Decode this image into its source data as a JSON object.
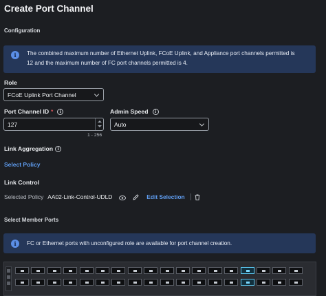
{
  "page": {
    "title": "Create Port Channel",
    "configuration_label": "Configuration",
    "info_banner_1": {
      "line1": "The combined maximum number of Ethernet Uplink, FCoE Uplink, and Appliance port channels permitted is",
      "line2": "12 and the maximum number of FC port channels permitted is 4."
    }
  },
  "role": {
    "label": "Role",
    "value": "FCoE Uplink Port Channel"
  },
  "port_channel_id": {
    "label": "Port Channel ID",
    "required_mark": "*",
    "value": "127",
    "range_hint": "1 - 256"
  },
  "admin_speed": {
    "label": "Admin Speed",
    "value": "Auto"
  },
  "link_aggregation": {
    "label": "Link Aggregation",
    "select_policy": "Select Policy"
  },
  "link_control": {
    "label": "Link Control",
    "selected_policy_label": "Selected Policy",
    "selected_policy_value": "AA02-Link-Control-UDLD",
    "edit_selection": "Edit Selection"
  },
  "member_ports": {
    "label": "Select Member Ports",
    "info_text": "FC or Ethernet ports with unconfigured role are available for port channel creation."
  },
  "colors": {
    "background": "#1c1e22",
    "banner": "#253759",
    "link": "#5f9df0",
    "required": "#e0565b",
    "selected_port": "#5cc8f2"
  }
}
